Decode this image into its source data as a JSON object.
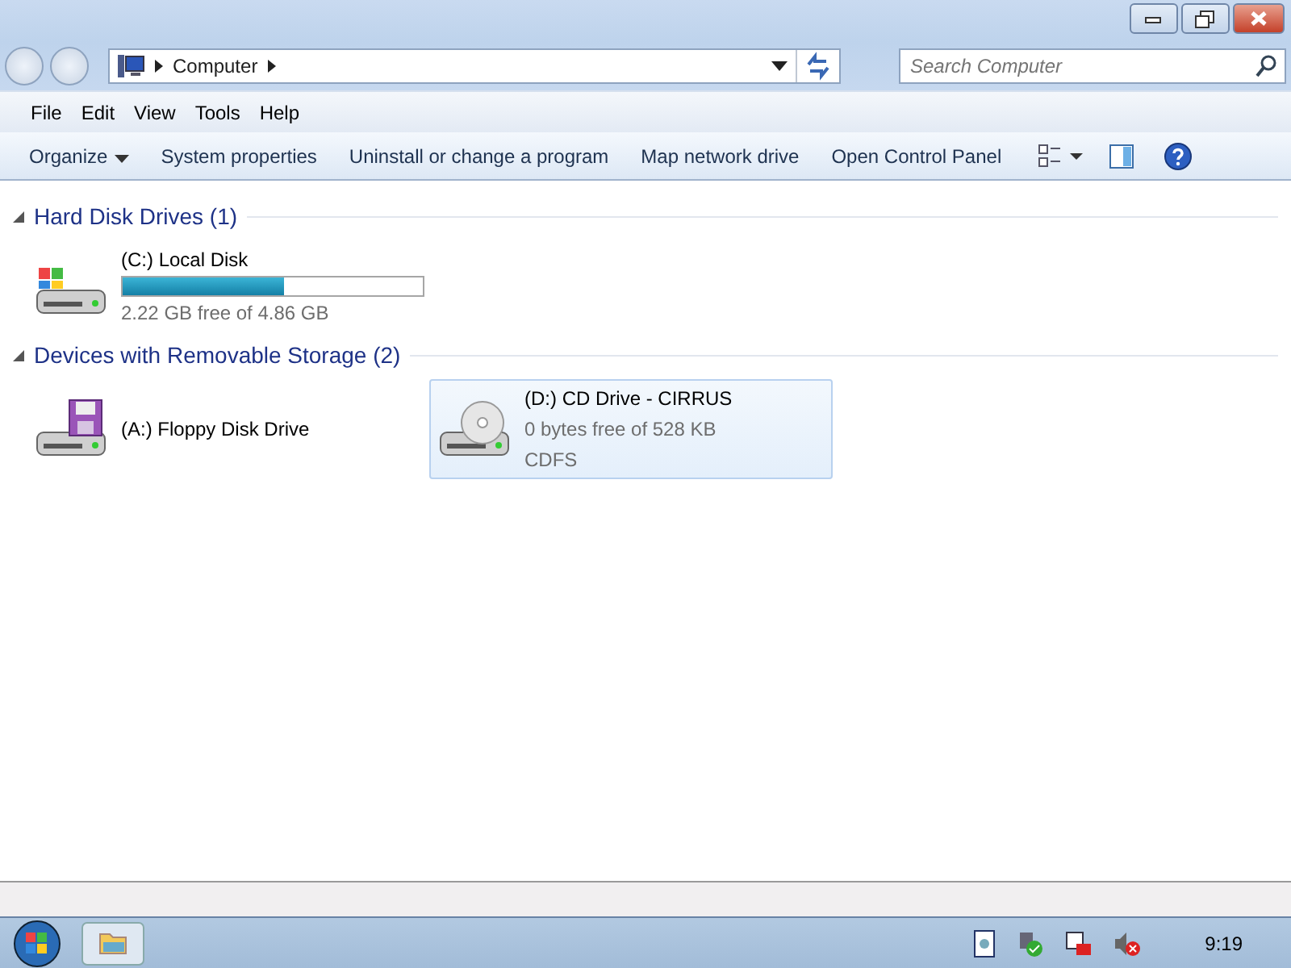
{
  "address_bar": {
    "path": [
      "Computer"
    ],
    "search_placeholder": "Search Computer"
  },
  "menu_bar": [
    {
      "label": "File"
    },
    {
      "label": "Edit"
    },
    {
      "label": "View"
    },
    {
      "label": "Tools"
    },
    {
      "label": "Help"
    }
  ],
  "command_bar": [
    {
      "label": "Organize",
      "kind": "dropdown"
    },
    {
      "label": "System properties",
      "kind": "button"
    },
    {
      "label": "Uninstall or change a program",
      "kind": "button"
    },
    {
      "label": "Map network drive",
      "kind": "button"
    },
    {
      "label": "Open Control Panel",
      "kind": "button"
    }
  ],
  "groups": [
    {
      "title": "Hard Disk Drives (1)",
      "expanded": true,
      "drives": [
        {
          "kind": "hdd",
          "name": "(C:) Local Disk",
          "level": 0.54,
          "details": [
            "2.22 GB free of 4.86 GB"
          ],
          "selected": false
        }
      ]
    },
    {
      "title": "Devices with Removable Storage (2)",
      "expanded": true,
      "drives": [
        {
          "kind": "floppy",
          "name": "(A:) Floppy Disk Drive",
          "selected": false
        },
        {
          "kind": "cd",
          "name": "(D:) CD Drive - CIRRUS",
          "details": [
            "0 bytes free of 528 KB",
            "CDFS"
          ],
          "selected": true
        }
      ]
    }
  ],
  "taskbar": {
    "clock": "9:19"
  }
}
